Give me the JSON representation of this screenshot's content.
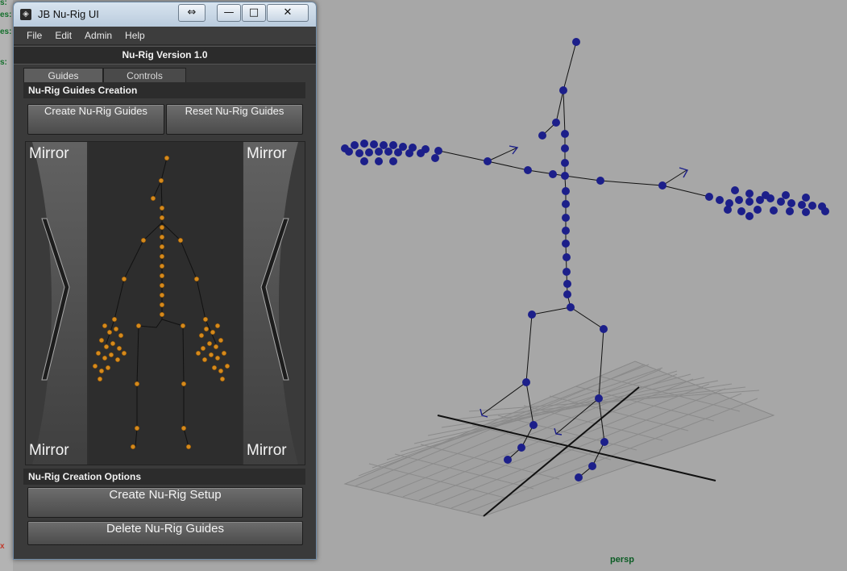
{
  "window": {
    "title": "JB Nu-Rig UI",
    "controls": {
      "resize": "⇔",
      "minimize": "—",
      "maximize": "□",
      "close": "✕"
    },
    "menu": [
      "File",
      "Edit",
      "Admin",
      "Help"
    ],
    "version": "Nu-Rig  Version 1.0",
    "tabs": [
      {
        "label": "Guides"
      },
      {
        "label": "Controls"
      }
    ],
    "guides_section": {
      "header": "Nu-Rig Guides Creation",
      "create_button": "Create Nu-Rig Guides",
      "reset_button": "Reset Nu-Rig Guides"
    },
    "mirror": {
      "label": "Mirror"
    },
    "options_section": {
      "header": "Nu-Rig Creation Options",
      "create_setup_button": "Create Nu-Rig Setup",
      "delete_button": "Delete Nu-Rig Guides"
    }
  },
  "viewport": {
    "camera_label": "persp",
    "left_strip_fragments": [
      "s:",
      "es:",
      "es:",
      "s:",
      "x"
    ]
  },
  "colors": {
    "joint_blue": "#1c1f8a",
    "guide_orange": "#d68a1c",
    "window_bg": "#3a3a3a",
    "viewport_bg": "#a7a7a7"
  }
}
